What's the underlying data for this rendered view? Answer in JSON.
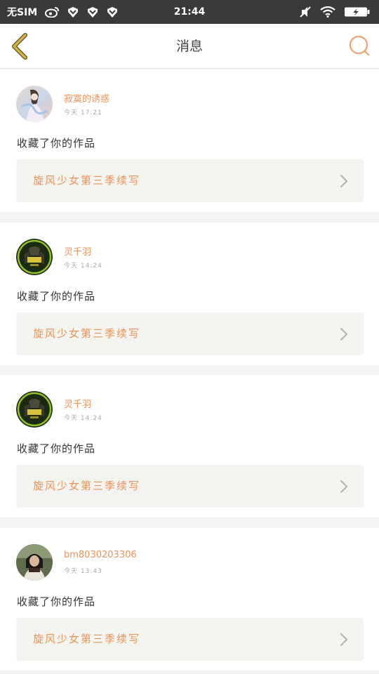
{
  "status_bar": {
    "carrier": "无SIM",
    "time": "21:44",
    "icons": [
      "weibo-icon",
      "notification-icon",
      "notification-icon",
      "notification-icon",
      "mute-icon",
      "wifi-icon",
      "battery-charging-icon"
    ]
  },
  "header": {
    "title": "消息",
    "back_icon": "chevron-left-icon",
    "search_icon": "search-icon"
  },
  "colors": {
    "accent": "#e8935c",
    "back_arrow": "#d4b04a",
    "card_bg": "#f3f3ef",
    "page_bg": "#f4f4f4"
  },
  "messages": [
    {
      "username": "寂寞的诱惑",
      "time": "今天 17:21",
      "action": "收藏了你的作品",
      "work_title": "旋风少女第三季续写",
      "avatar": "anime-girl-avatar"
    },
    {
      "username": "灵千羽",
      "time": "今天 14:24",
      "action": "收藏了你的作品",
      "work_title": "旋风少女第三季续写",
      "avatar": "game-logo-avatar"
    },
    {
      "username": "灵千羽",
      "time": "今天 14:24",
      "action": "收藏了你的作品",
      "work_title": "旋风少女第三季续写",
      "avatar": "game-logo-avatar"
    },
    {
      "username": "bm8030203306",
      "time": "今天 13:43",
      "action": "收藏了你的作品",
      "work_title": "旋风少女第三季续写",
      "avatar": "photo-person-avatar"
    }
  ]
}
